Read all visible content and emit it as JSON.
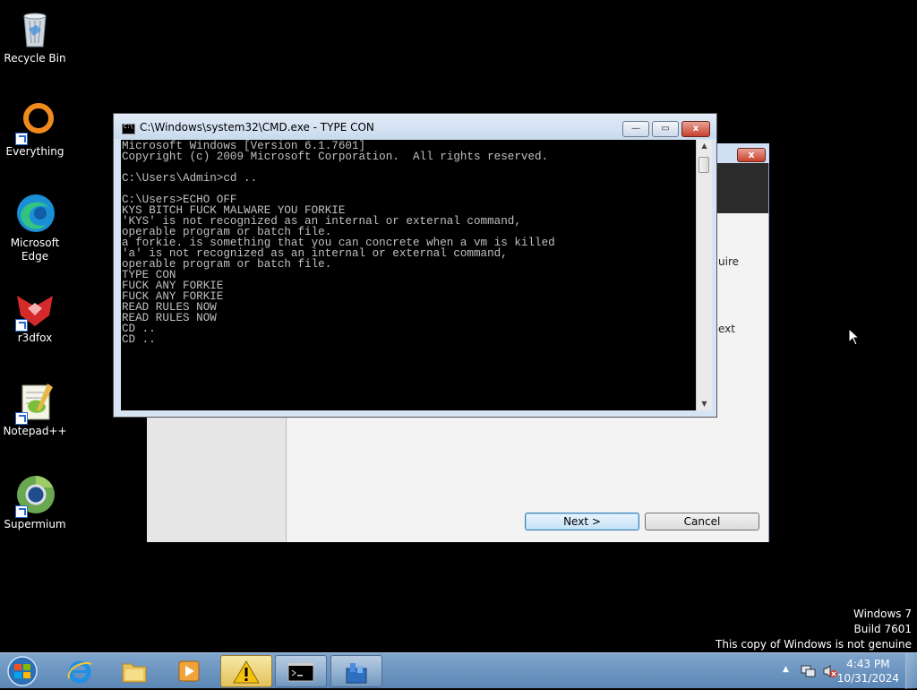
{
  "desktop": {
    "icons": [
      {
        "label": "Recycle Bin",
        "icon": "recycle-bin-icon"
      },
      {
        "label": "Everything",
        "icon": "everything-icon"
      },
      {
        "label": "Microsoft Edge",
        "icon": "edge-icon"
      },
      {
        "label": "r3dfox",
        "icon": "r3dfox-icon"
      },
      {
        "label": "Notepad++",
        "icon": "notepad-plus-plus-icon"
      },
      {
        "label": "Supermium",
        "icon": "supermium-icon"
      }
    ]
  },
  "setup_window": {
    "close_label": "x",
    "partial_text_1": "uire",
    "partial_text_2": "ext",
    "next_label": "Next >",
    "cancel_label": "Cancel"
  },
  "cmd_window": {
    "title": "C:\\Windows\\system32\\CMD.exe - TYPE  CON",
    "minimize_label": "—",
    "maximize_label": "▭",
    "close_label": "x",
    "console_text": "Microsoft Windows [Version 6.1.7601]\nCopyright (c) 2009 Microsoft Corporation.  All rights reserved.\n\nC:\\Users\\Admin>cd ..\n\nC:\\Users>ECHO OFF\nKYS BITCH FUCK MALWARE YOU FORKIE\n'KYS' is not recognized as an internal or external command,\noperable program or batch file.\na forkie. is something that you can concrete when a vm is killed\n'a' is not recognized as an internal or external command,\noperable program or batch file.\nTYPE CON\nFUCK ANY FORKIE\nFUCK ANY FORKIE\nREAD RULES NOW\nREAD RULES NOW\nCD ..\nCD .."
  },
  "watermark": {
    "line1": "Windows 7",
    "line2": "Build 7601",
    "line3": "This copy of Windows is not genuine"
  },
  "taskbar": {
    "items": [
      {
        "name": "internet-explorer",
        "icon": "ie-icon"
      },
      {
        "name": "file-explorer",
        "icon": "folder-icon"
      },
      {
        "name": "media-player",
        "icon": "media-player-icon"
      },
      {
        "name": "warning-app",
        "icon": "warning-icon"
      },
      {
        "name": "cmd",
        "icon": "cmd-icon"
      },
      {
        "name": "setup",
        "icon": "setup-icon"
      }
    ],
    "time": "4:43 PM",
    "date": "10/31/2024"
  }
}
